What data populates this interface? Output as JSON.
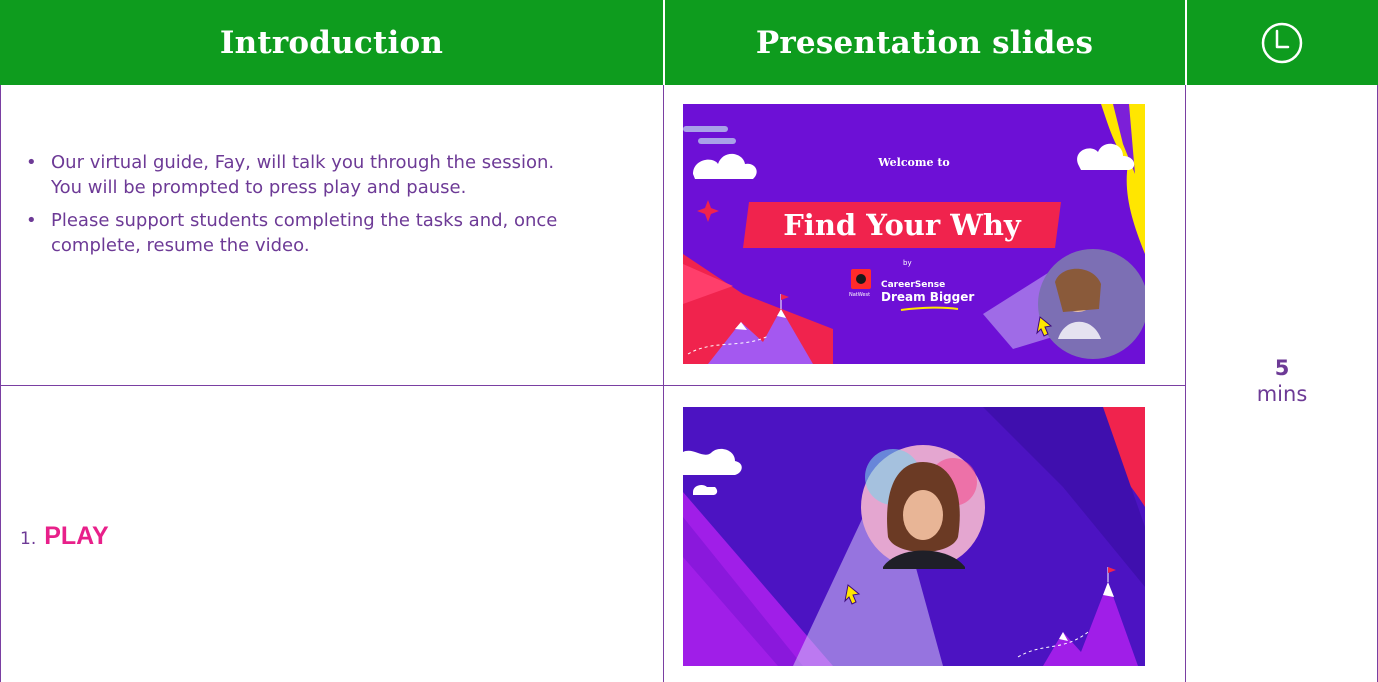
{
  "header": {
    "col1_title": "Introduction",
    "col2_title": "Presentation slides",
    "col3_icon": "clock-icon"
  },
  "introduction": {
    "bullets": [
      "Our virtual guide, Fay, will talk you through the session. You will be prompted to press play and pause.",
      "Please support students completing the tasks and, once complete, resume the video."
    ],
    "play_step": {
      "number": "1.",
      "label": "PLAY"
    }
  },
  "timing": {
    "value": "5",
    "unit": "mins"
  },
  "slides": {
    "slide1": {
      "welcome": "Welcome to",
      "title": "Find Your Why",
      "by": "by",
      "brand_small": "NatWest",
      "brand_line1": "CareerSense",
      "brand_line2": "Dream Bigger"
    }
  },
  "colors": {
    "header_green": "#0e9c1e",
    "text_purple": "#6d3a96",
    "play_pink": "#e8208a",
    "slide_purple": "#6d10d6",
    "accent_red": "#f0234d",
    "accent_yellow": "#ffe600"
  }
}
